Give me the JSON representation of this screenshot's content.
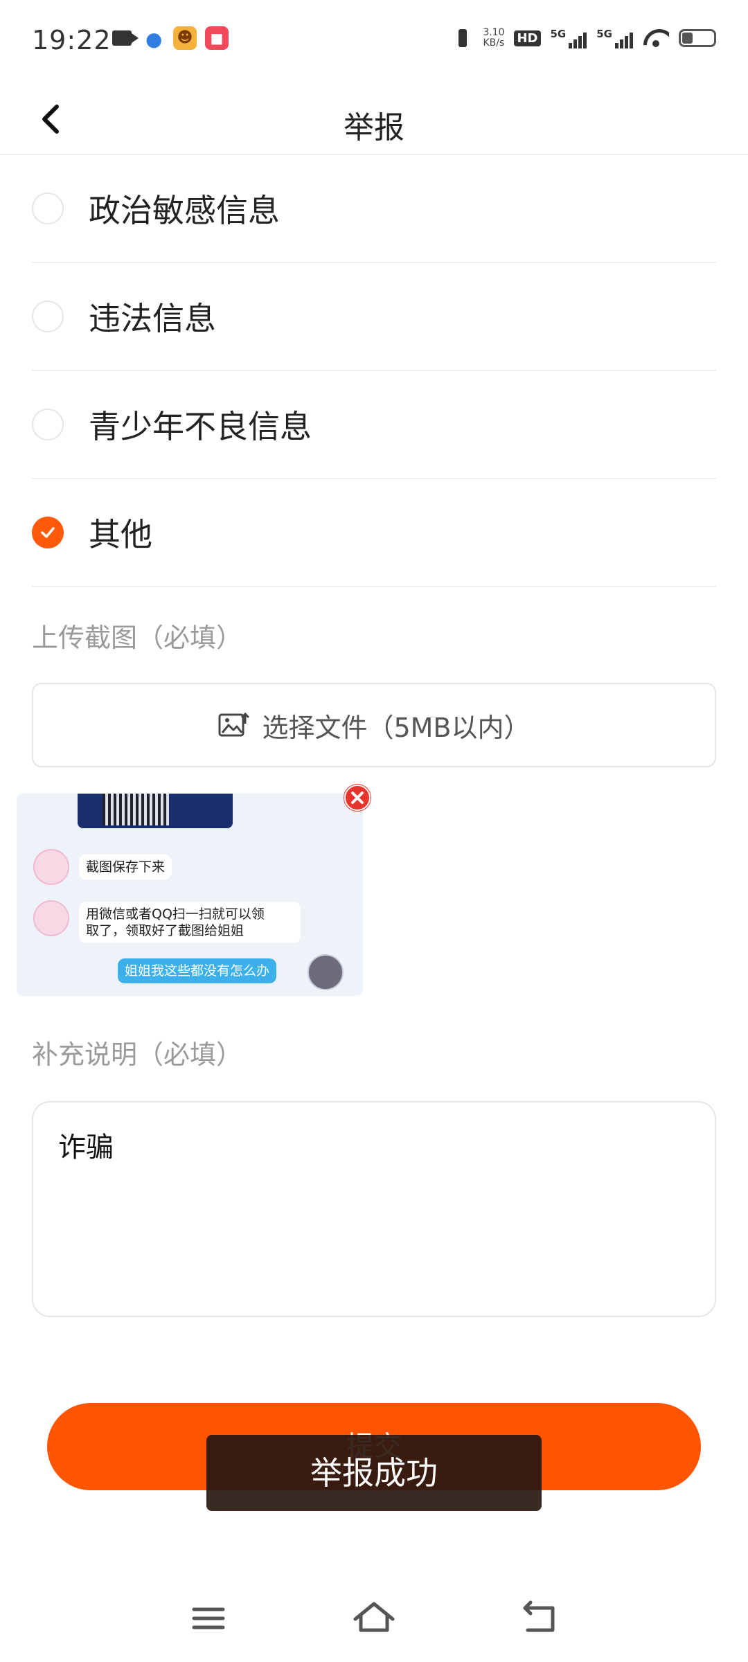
{
  "status_bar": {
    "time": "19:22",
    "net_speed_value": "3.10",
    "net_speed_unit": "KB/s",
    "hd_badge": "HD",
    "signal_1_label": "5G",
    "signal_2_label": "5G",
    "battery_level": 0.35
  },
  "header": {
    "title": "举报",
    "back_icon": "chevron-left-icon"
  },
  "options": [
    {
      "label": "政治敏感信息",
      "checked": false
    },
    {
      "label": "违法信息",
      "checked": false
    },
    {
      "label": "青少年不良信息",
      "checked": false
    },
    {
      "label": "其他",
      "checked": true
    }
  ],
  "upload": {
    "section_label": "上传截图（必填）",
    "button_label": "选择文件（5MB以内）",
    "icon": "image-upload-icon"
  },
  "screenshot_preview": {
    "bubble_1": "截图保存下来",
    "bubble_2_line_1": "用微信或者QQ扫一扫就可以领",
    "bubble_2_line_2": "取了，领取好了截图给姐姐",
    "bubble_3": "姐姐我这些都没有怎么办",
    "remove_icon": "close-circle-icon"
  },
  "description": {
    "section_label": "补充说明（必填）",
    "value": "诈骗"
  },
  "submit": {
    "label": "提交"
  },
  "toast": {
    "message": "举报成功"
  },
  "colors": {
    "accent": "#ff5500",
    "checked_radio": "#ff5a0a",
    "remove_icon": "#e8342a"
  },
  "nav_bar": {
    "menu_icon": "menu-icon",
    "home_icon": "home-icon",
    "back_icon": "back-icon"
  }
}
